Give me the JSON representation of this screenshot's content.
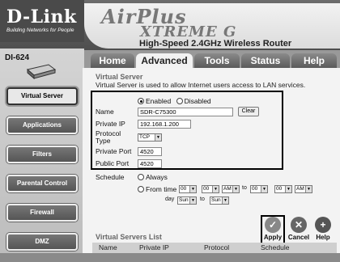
{
  "brand": {
    "logo": "D-Link",
    "tagline": "Building Networks for People",
    "product_line1": "AirPlus",
    "product_line2": "XTREME G",
    "subtitle": "High-Speed 2.4GHz Wireless Router",
    "model": "DI-624"
  },
  "tabs": [
    "Home",
    "Advanced",
    "Tools",
    "Status",
    "Help"
  ],
  "active_tab": "Advanced",
  "sidebar": [
    "Virtual Server",
    "Applications",
    "Filters",
    "Parental Control",
    "Firewall",
    "DMZ"
  ],
  "section": {
    "title": "Virtual Server",
    "description": "Virtual Server is used to allow Internet users access to LAN services."
  },
  "form": {
    "enabled_label": "Enabled",
    "disabled_label": "Disabled",
    "enabled_selected": true,
    "name_label": "Name",
    "name_value": "SDR-C75300",
    "clear_label": "Clear",
    "private_ip_label": "Private IP",
    "private_ip_value": "192.168.1.200",
    "protocol_label": "Protocol Type",
    "protocol_value": "TCP",
    "private_port_label": "Private Port",
    "private_port_value": "4520",
    "public_port_label": "Public Port",
    "public_port_value": "4520"
  },
  "schedule": {
    "label": "Schedule",
    "always_label": "Always",
    "fromtime_label": "From time",
    "from_hour": "00",
    "from_min": "00",
    "from_ampm": "AM",
    "to_label": "to",
    "to_hour": "00",
    "to_min": "00",
    "to_ampm": "AM",
    "day_label": "day",
    "day_from": "Sun",
    "day_to_label": "to",
    "day_to": "Sun"
  },
  "actions": {
    "apply": "Apply",
    "cancel": "Cancel",
    "help": "Help"
  },
  "list": {
    "title": "Virtual Servers List",
    "columns": [
      "Name",
      "Private IP",
      "Protocol",
      "Schedule"
    ]
  }
}
